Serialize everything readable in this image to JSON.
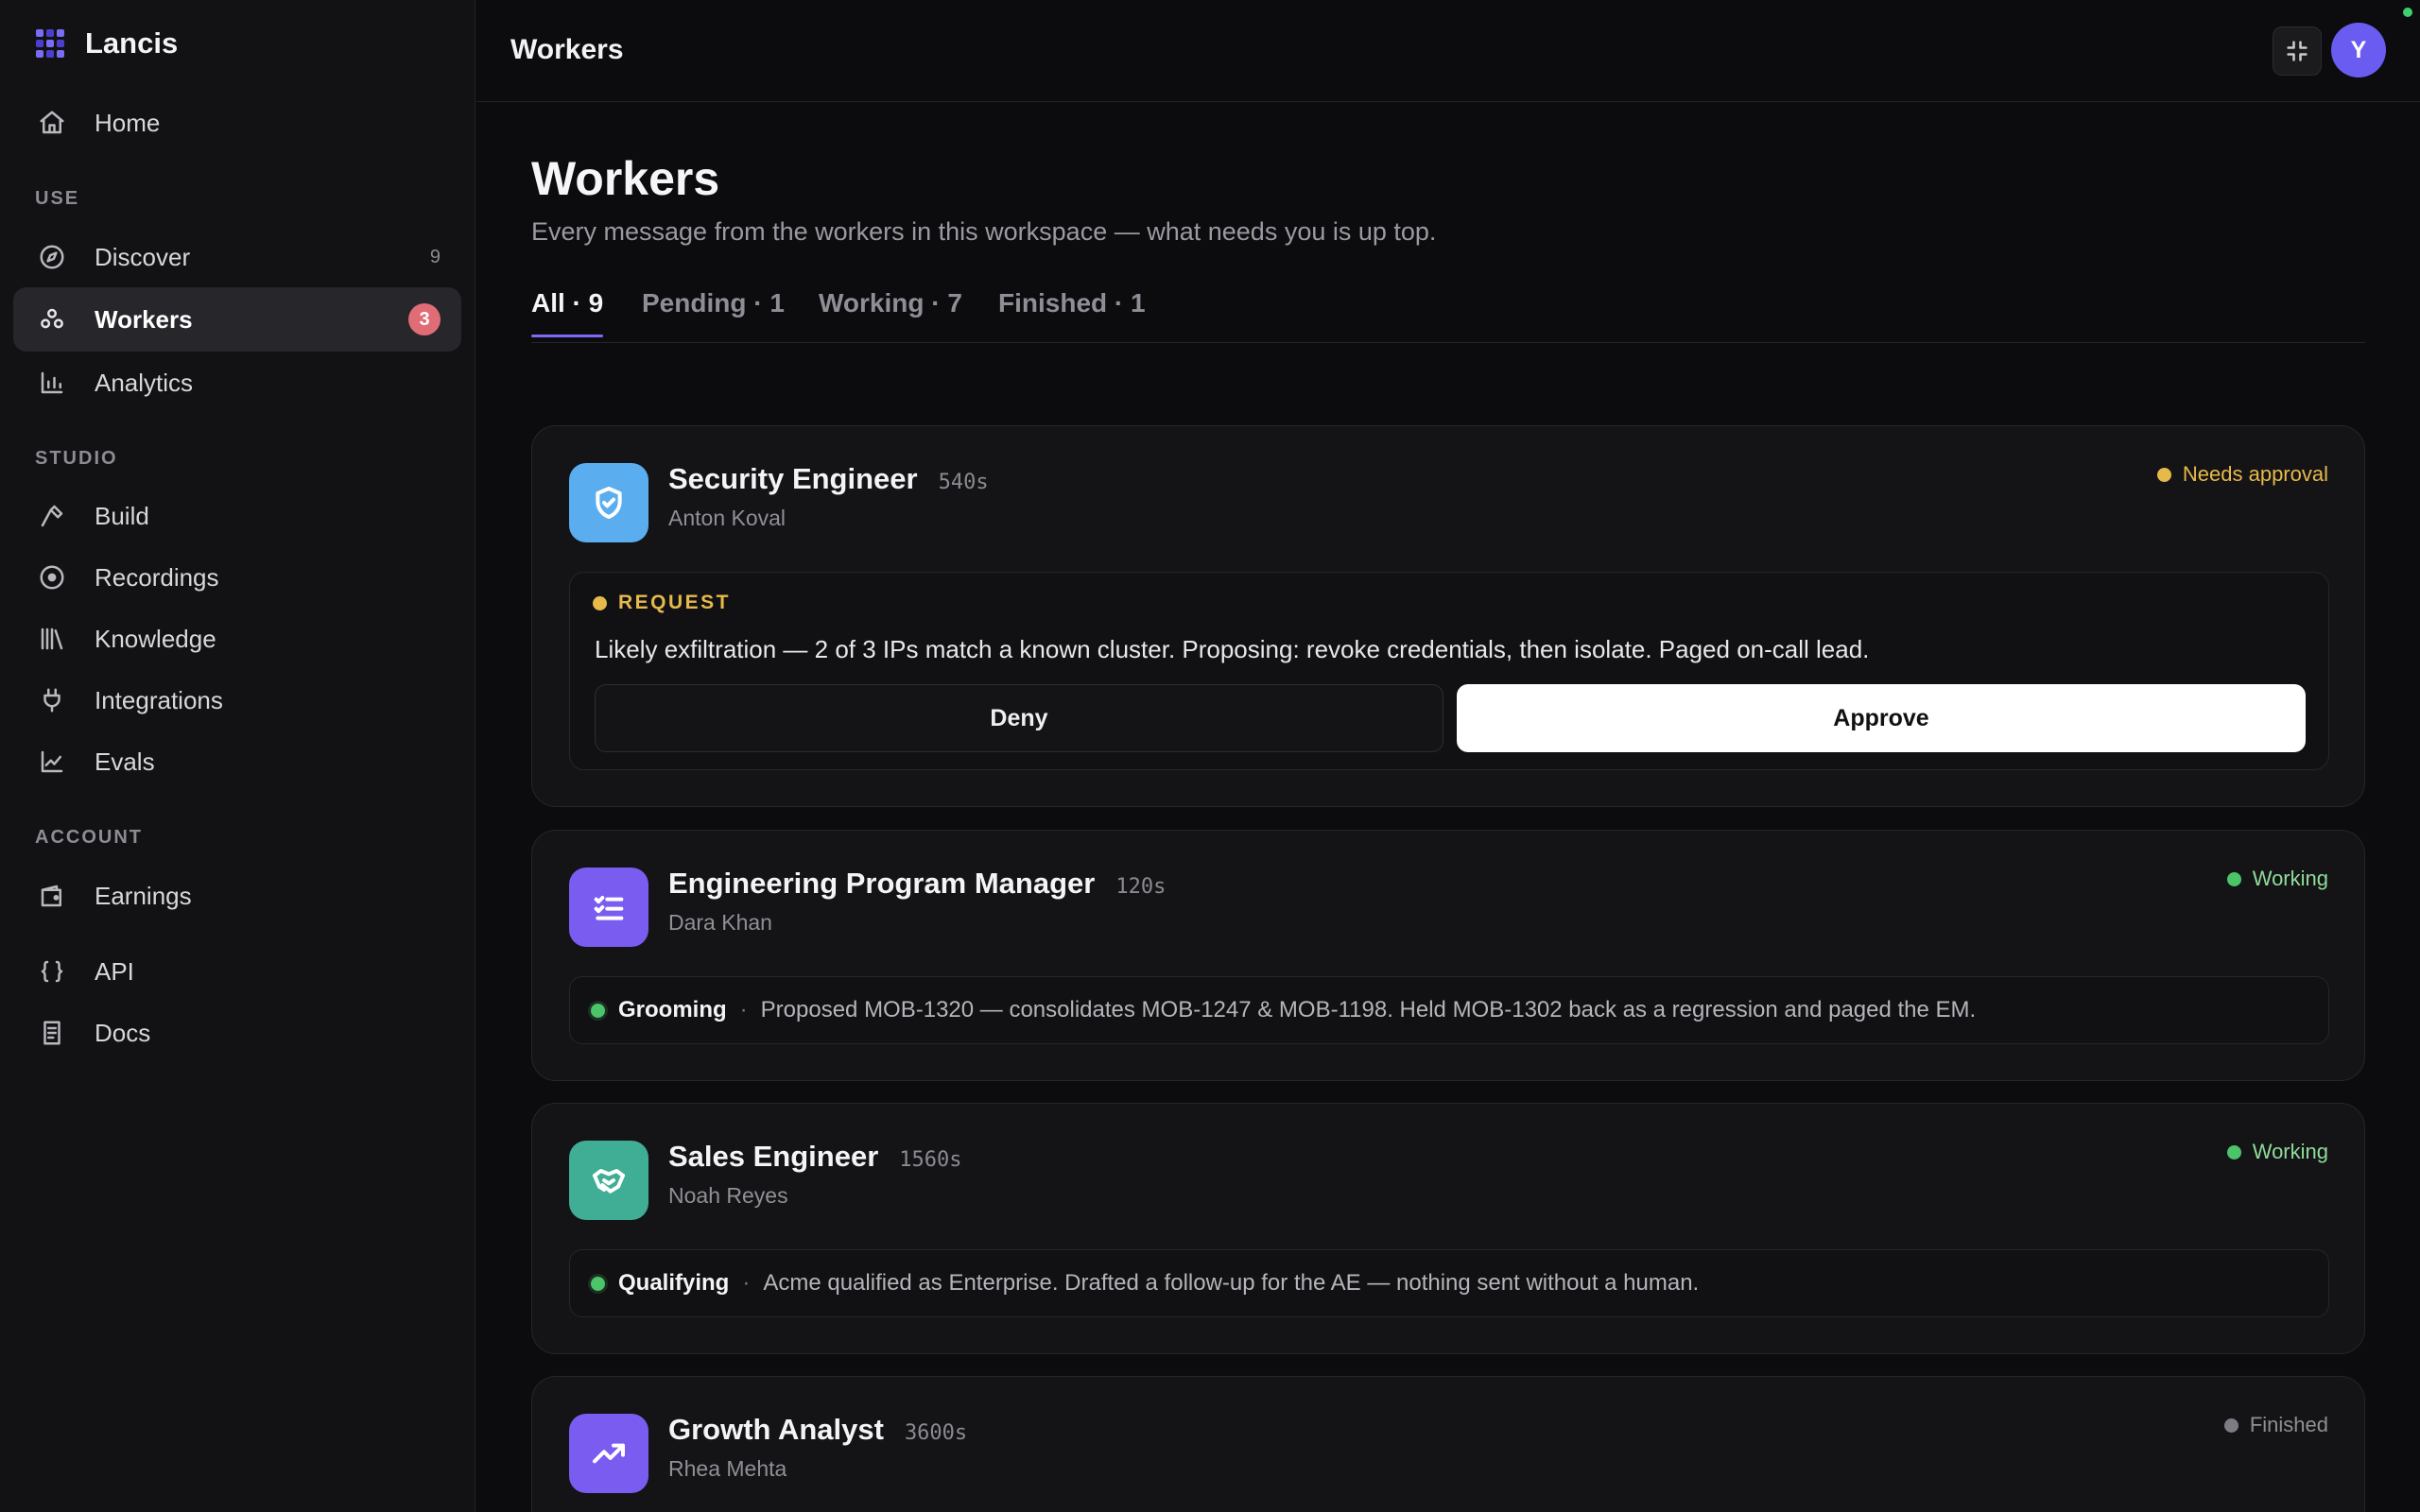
{
  "brand": {
    "name": "Lancis"
  },
  "sidebar": {
    "home": {
      "label": "Home"
    },
    "sections": {
      "use": "USE",
      "studio": "STUDIO",
      "account": "ACCOUNT"
    },
    "use_items": [
      {
        "label": "Discover",
        "count": "9",
        "icon": "compass-icon"
      },
      {
        "label": "Workers",
        "badge": "3",
        "icon": "workers-icon",
        "active": true
      },
      {
        "label": "Analytics",
        "icon": "bar-chart-icon"
      }
    ],
    "studio_items": [
      {
        "label": "Build",
        "icon": "hammer-icon"
      },
      {
        "label": "Recordings",
        "icon": "record-icon"
      },
      {
        "label": "Knowledge",
        "icon": "library-icon"
      },
      {
        "label": "Integrations",
        "icon": "plug-icon"
      },
      {
        "label": "Evals",
        "icon": "line-chart-icon"
      }
    ],
    "account_items": [
      {
        "label": "Earnings",
        "icon": "wallet-icon"
      },
      {
        "label": "API",
        "icon": "braces-icon"
      },
      {
        "label": "Docs",
        "icon": "book-icon"
      }
    ]
  },
  "topbar": {
    "title": "Workers",
    "avatar_initial": "Y"
  },
  "page": {
    "title": "Workers",
    "subtitle": "Every message from the workers in this workspace — what needs you is up top."
  },
  "tabs": [
    {
      "label": "All · 9",
      "active": true
    },
    {
      "label": "Pending · 1"
    },
    {
      "label": "Working · 7"
    },
    {
      "label": "Finished · 1"
    }
  ],
  "workers": [
    {
      "title": "Security Engineer",
      "time": "540s",
      "owner": "Anton Koval",
      "status": "Needs approval",
      "status_color": "#e6b94a",
      "icon": "shield-icon",
      "icon_bg": "#5aaef0",
      "request": {
        "label": "REQUEST",
        "text": "Likely exfiltration — 2 of 3 IPs match a known cluster. Proposing: revoke credentials, then isolate. Paged on-call lead.",
        "deny": "Deny",
        "approve": "Approve"
      }
    },
    {
      "title": "Engineering Program Manager",
      "time": "120s",
      "owner": "Dara Khan",
      "status": "Working",
      "status_color": "#8fdc9a",
      "icon": "checklist-icon",
      "icon_bg": "#7a5cf0",
      "activity": {
        "label": "Grooming",
        "text": "Proposed MOB-1320 — consolidates MOB-1247 & MOB-1198. Held MOB-1302 back as a regression and paged the EM."
      }
    },
    {
      "title": "Sales Engineer",
      "time": "1560s",
      "owner": "Noah Reyes",
      "status": "Working",
      "status_color": "#8fdc9a",
      "icon": "handshake-icon",
      "icon_bg": "#3fae94",
      "activity": {
        "label": "Qualifying",
        "text": "Acme qualified as Enterprise. Drafted a follow-up for the AE — nothing sent without a human."
      }
    },
    {
      "title": "Growth Analyst",
      "time": "3600s",
      "owner": "Rhea Mehta",
      "status": "Finished",
      "status_color": "#8e8e96",
      "icon": "trending-up-icon",
      "icon_bg": "#7a5cf0"
    }
  ],
  "activity_separator": "·"
}
